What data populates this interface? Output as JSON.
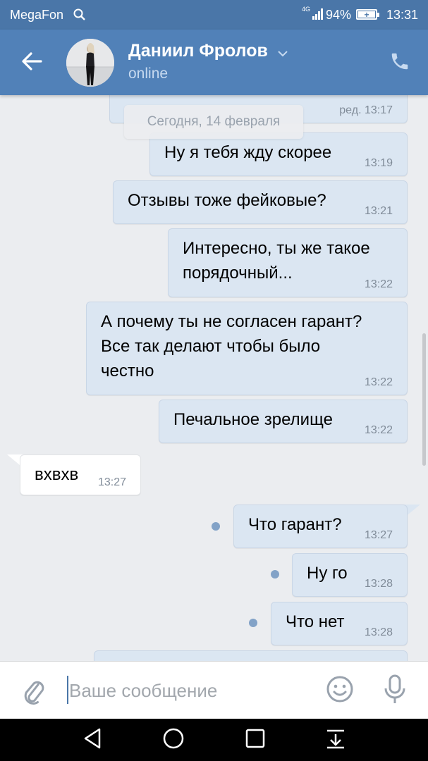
{
  "status_bar": {
    "carrier": "MegaFon",
    "network": "4G",
    "battery_percent": "94%",
    "battery_level": 0.94,
    "time": "13:31"
  },
  "header": {
    "contact_name": "Даниил Фролов",
    "contact_status": "online",
    "icons": [
      "arrow-left-icon",
      "chevron-down-icon",
      "phone-icon"
    ]
  },
  "chat": {
    "top_partial_time": "ред. 13:17",
    "date_divider": "Сегодня, 14 февраля",
    "messages": [
      {
        "dir": "out",
        "text": "Ну я тебя жду скорее",
        "time": "13:19"
      },
      {
        "dir": "out",
        "text": "Отзывы тоже фейковые?",
        "time": "13:21"
      },
      {
        "dir": "out",
        "text": "Интересно, ты же такое\nпорядочный...",
        "time": "13:22"
      },
      {
        "dir": "out",
        "text": "А почему ты не согласен гарант?\nВсе так делают чтобы было\nчестно",
        "time": "13:22"
      },
      {
        "dir": "out",
        "text": "Печальное зрелище",
        "time": "13:22"
      },
      {
        "dir": "in",
        "text": "вхвхв",
        "time": "13:27"
      },
      {
        "dir": "out",
        "text": "Что гарант?",
        "time": "13:27",
        "unread": true
      },
      {
        "dir": "out",
        "text": "Ну го",
        "time": "13:28",
        "unread": true
      },
      {
        "dir": "out",
        "text": "Что нет",
        "time": "13:28",
        "unread": true
      }
    ]
  },
  "composer": {
    "placeholder": "Ваше сообщение",
    "value": ""
  },
  "colors": {
    "status_bar": "#4a76a8",
    "header": "#5181b8",
    "outgoing_bubble": "#dbe6f2",
    "incoming_bubble": "#ffffff",
    "chat_background": "#ebedf0",
    "unread_dot": "#82a2c7"
  }
}
